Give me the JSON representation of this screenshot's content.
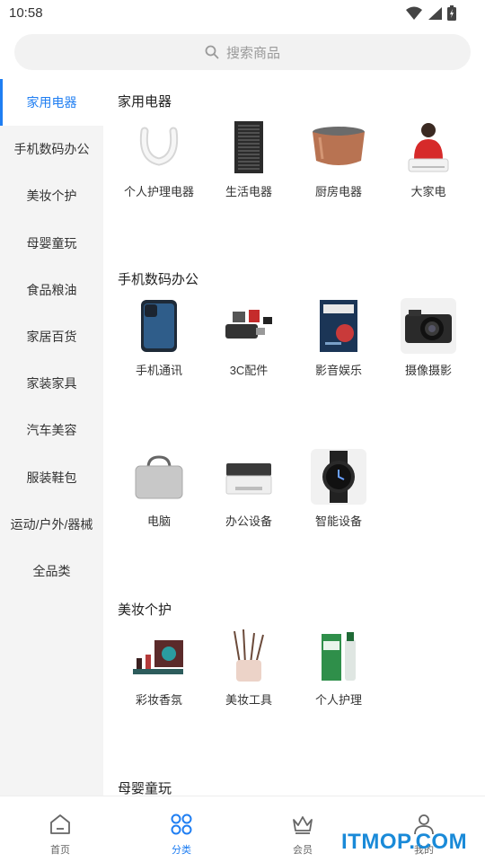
{
  "status_bar": {
    "time": "10:58"
  },
  "search": {
    "placeholder": "搜索商品"
  },
  "sidebar": {
    "items": [
      {
        "label": "家用电器",
        "active": true
      },
      {
        "label": "手机数码办公"
      },
      {
        "label": "美妆个护"
      },
      {
        "label": "母婴童玩"
      },
      {
        "label": "食品粮油"
      },
      {
        "label": "家居百货"
      },
      {
        "label": "家装家具"
      },
      {
        "label": "汽车美容"
      },
      {
        "label": "服装鞋包"
      },
      {
        "label": "运动/户外/器械"
      },
      {
        "label": "全品类"
      }
    ]
  },
  "content": {
    "sections": [
      {
        "title": "家用电器",
        "items": [
          "个人护理电器",
          "生活电器",
          "厨房电器",
          "大家电"
        ]
      },
      {
        "title": "手机数码办公",
        "items": [
          "手机通讯",
          "3C配件",
          "影音娱乐",
          "摄像摄影",
          "电脑",
          "办公设备",
          "智能设备"
        ]
      },
      {
        "title": "美妆个护",
        "items": [
          "彩妆香氛",
          "美妆工具",
          "个人护理"
        ]
      },
      {
        "title": "母婴童玩",
        "items": []
      }
    ]
  },
  "bottom_nav": {
    "items": [
      {
        "label": "首页",
        "icon": "home-icon"
      },
      {
        "label": "分类",
        "icon": "category-icon",
        "active": true
      },
      {
        "label": "会员",
        "icon": "crown-icon"
      },
      {
        "label": "我的",
        "icon": "user-icon"
      }
    ]
  },
  "watermark": {
    "text": "ITMOP.COM"
  },
  "colors": {
    "accent": "#1f7ef2",
    "sidebar_bg": "#f4f4f4",
    "search_bg": "#f2f2f2",
    "watermark": "#1a8ad8"
  }
}
